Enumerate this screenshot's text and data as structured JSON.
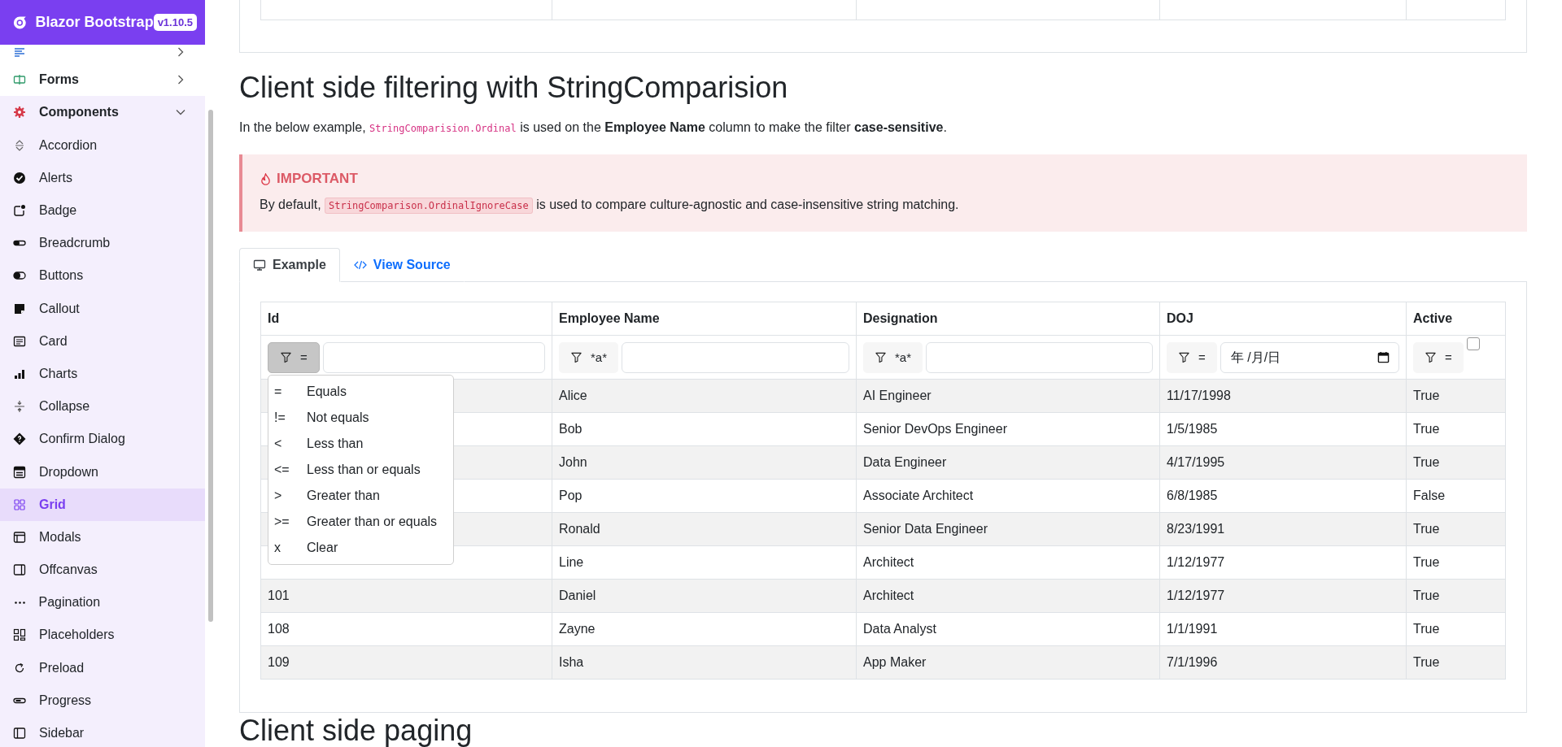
{
  "header": {
    "brand": "Blazor Bootstrap",
    "version": "v1.10.5"
  },
  "sidebar": {
    "items": [
      {
        "expanded": false
      },
      {
        "label": "Forms",
        "expanded": false
      },
      {
        "label": "Components",
        "expanded": true,
        "children": [
          {
            "label": "Accordion",
            "selected": false
          },
          {
            "label": "Alerts",
            "selected": false
          },
          {
            "label": "Badge",
            "selected": false
          },
          {
            "label": "Breadcrumb",
            "selected": false
          },
          {
            "label": "Buttons",
            "selected": false
          },
          {
            "label": "Callout",
            "selected": false
          },
          {
            "label": "Card",
            "selected": false
          },
          {
            "label": "Charts",
            "selected": false
          },
          {
            "label": "Collapse",
            "selected": false
          },
          {
            "label": "Confirm Dialog",
            "selected": false
          },
          {
            "label": "Dropdown",
            "selected": false
          },
          {
            "label": "Grid",
            "selected": true
          },
          {
            "label": "Modals",
            "selected": false
          },
          {
            "label": "Offcanvas",
            "selected": false
          },
          {
            "label": "Pagination",
            "selected": false
          },
          {
            "label": "Placeholders",
            "selected": false
          },
          {
            "label": "Preload",
            "selected": false
          },
          {
            "label": "Progress",
            "selected": false
          },
          {
            "label": "Sidebar",
            "selected": false
          }
        ]
      }
    ]
  },
  "section": {
    "title": "Client side filtering with StringComparision",
    "intro": [
      {
        "kind": "text",
        "text": "In the below example, "
      },
      {
        "kind": "code",
        "text": "StringComparision.Ordinal"
      },
      {
        "kind": "text",
        "text": " is used on the **Employee Name** column to make the filter **case-sensitive**."
      }
    ],
    "callout": {
      "title": "IMPORTANT",
      "body": [
        {
          "kind": "text",
          "text": "By default, "
        },
        {
          "kind": "code",
          "text": "StringComparison.OrdinalIgnoreCase"
        },
        {
          "kind": "text",
          "text": " is used to compare culture-agnostic and case-insensitive string matching."
        }
      ]
    },
    "tabs": [
      {
        "label": "Example",
        "selected": true
      },
      {
        "label": "View Source",
        "selected": false
      }
    ],
    "grid": {
      "columns": [
        {
          "label": "Id",
          "filter": {
            "operator": "=",
            "kind": "text",
            "open": true
          }
        },
        {
          "label": "Employee Name",
          "filter": {
            "operator": "*a*",
            "kind": "text",
            "open": false
          }
        },
        {
          "label": "Designation",
          "filter": {
            "operator": "*a*",
            "kind": "text",
            "open": false
          }
        },
        {
          "label": "DOJ",
          "filter": {
            "operator": "=",
            "kind": "date",
            "placeholder": "年 /月/日",
            "open": false
          }
        },
        {
          "label": "Active",
          "filter": {
            "operator": "=",
            "kind": "checkbox",
            "checked": false,
            "open": false
          }
        }
      ],
      "filter_menu": [
        {
          "symbol": "=",
          "label": "Equals"
        },
        {
          "symbol": "!=",
          "label": "Not equals"
        },
        {
          "symbol": "<",
          "label": "Less than"
        },
        {
          "symbol": "<=",
          "label": "Less than or equals"
        },
        {
          "symbol": ">",
          "label": "Greater than"
        },
        {
          "symbol": ">=",
          "label": "Greater than or equals"
        },
        {
          "symbol": "x",
          "label": "Clear"
        }
      ],
      "rows": [
        {
          "name": "Alice",
          "designation": "AI Engineer",
          "doj": "11/17/1998",
          "active": "True"
        },
        {
          "name": "Bob",
          "designation": "Senior DevOps Engineer",
          "doj": "1/5/1985",
          "active": "True"
        },
        {
          "name": "John",
          "designation": "Data Engineer",
          "doj": "4/17/1995",
          "active": "True"
        },
        {
          "name": "Pop",
          "designation": "Associate Architect",
          "doj": "6/8/1985",
          "active": "False"
        },
        {
          "name": "Ronald",
          "designation": "Senior Data Engineer",
          "doj": "8/23/1991",
          "active": "True"
        },
        {
          "name": "Line",
          "designation": "Architect",
          "doj": "1/12/1977",
          "active": "True"
        },
        {
          "id": "101",
          "name": "Daniel",
          "designation": "Architect",
          "doj": "1/12/1977",
          "active": "True"
        },
        {
          "id": "108",
          "name": "Zayne",
          "designation": "Data Analyst",
          "doj": "1/1/1991",
          "active": "True"
        },
        {
          "id": "109",
          "name": "Isha",
          "designation": "App Maker",
          "doj": "7/1/1996",
          "active": "True"
        }
      ]
    }
  },
  "next_heading": "Client side paging"
}
